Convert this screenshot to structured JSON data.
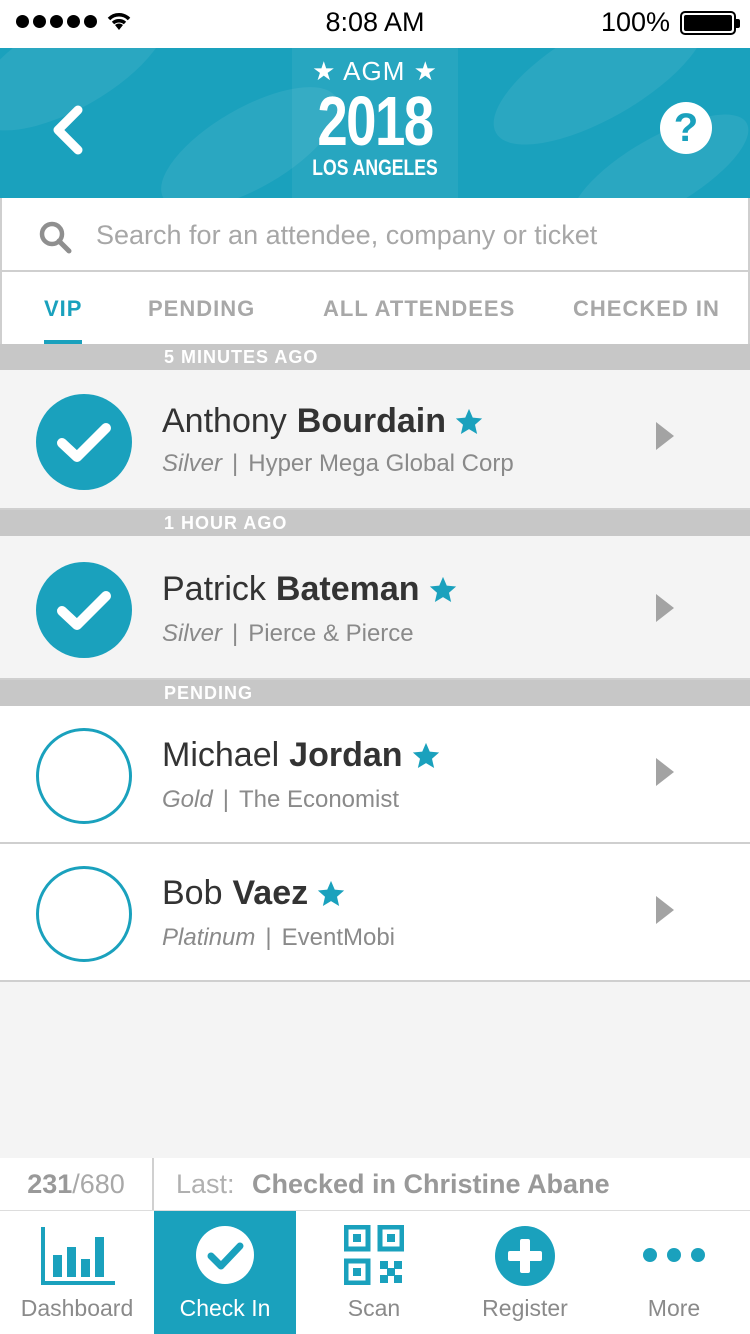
{
  "status_bar": {
    "time": "8:08 AM",
    "battery": "100%"
  },
  "header": {
    "logo_top": "★ AGM ★",
    "logo_year": "2018",
    "logo_city": "LOS ANGELES",
    "help_label": "?"
  },
  "search": {
    "placeholder": "Search for an attendee, company or ticket"
  },
  "tabs": [
    {
      "label": "VIP",
      "active": true
    },
    {
      "label": "PENDING",
      "active": false
    },
    {
      "label": "ALL ATTENDEES",
      "active": false
    },
    {
      "label": "CHECKED IN",
      "active": false
    }
  ],
  "sections": [
    {
      "header": "5 MINUTES AGO"
    },
    {
      "header": "1 HOUR AGO"
    },
    {
      "header": "PENDING"
    }
  ],
  "attendees": [
    {
      "first": "Anthony",
      "last": "Bourdain",
      "tier": "Silver",
      "company": "Hyper Mega Global Corp",
      "checked_in": true
    },
    {
      "first": "Patrick",
      "last": "Bateman",
      "tier": "Silver",
      "company": "Pierce & Pierce",
      "checked_in": true
    },
    {
      "first": "Michael",
      "last": "Jordan",
      "tier": "Gold",
      "company": "The Economist",
      "checked_in": false
    },
    {
      "first": "Bob",
      "last": "Vaez",
      "tier": "Platinum",
      "company": "EventMobi",
      "checked_in": false
    }
  ],
  "stats": {
    "checked": "231",
    "total": "/680",
    "last_label": "Last:",
    "last_value": "Checked in Christine Abane"
  },
  "nav": [
    {
      "label": "Dashboard",
      "icon": "bar-chart-icon",
      "active": false
    },
    {
      "label": "Check In",
      "icon": "check-circle-icon",
      "active": true
    },
    {
      "label": "Scan",
      "icon": "qr-code-icon",
      "active": false
    },
    {
      "label": "Register",
      "icon": "plus-circle-icon",
      "active": false
    },
    {
      "label": "More",
      "icon": "more-dots-icon",
      "active": false
    }
  ],
  "colors": {
    "accent": "#1aa1bd",
    "section_bg": "#c7c7c7",
    "text_dark": "#333333",
    "text_muted": "#8a8a8a"
  }
}
